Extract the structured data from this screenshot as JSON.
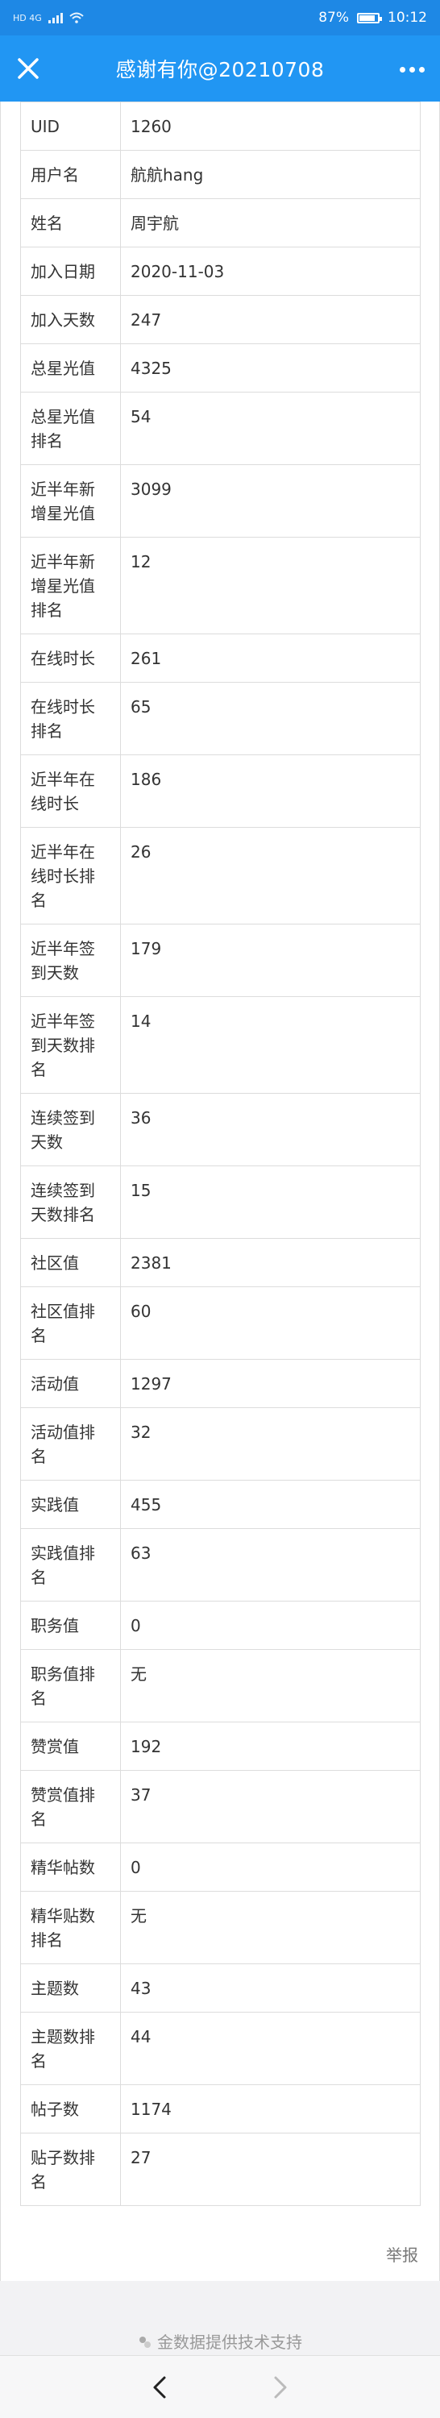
{
  "status_bar": {
    "carrier_text": "HD 4G",
    "battery": "87%",
    "time": "10:12"
  },
  "header": {
    "title": "感谢有你@20210708",
    "close_icon": "close-icon",
    "more_icon": "more-icon"
  },
  "table": {
    "rows": [
      {
        "k": "UID",
        "v": "1260",
        "lines": 1
      },
      {
        "k": "用户名",
        "v": "航航hang",
        "lines": 1
      },
      {
        "k": "姓名",
        "v": "周宇航",
        "lines": 1
      },
      {
        "k": "加入日期",
        "v": "2020-11-03",
        "lines": 1
      },
      {
        "k": "加入天数",
        "v": "247",
        "lines": 1
      },
      {
        "k": "总星光值",
        "v": "4325",
        "lines": 1
      },
      {
        "k": "总星光值排名",
        "v": "54",
        "lines": 2
      },
      {
        "k": "近半年新增星光值",
        "v": "3099",
        "lines": 2
      },
      {
        "k": "近半年新增星光值排名",
        "v": "12",
        "lines": 3
      },
      {
        "k": "在线时长",
        "v": "261",
        "lines": 1
      },
      {
        "k": "在线时长排名",
        "v": "65",
        "lines": 2
      },
      {
        "k": "近半年在线时长",
        "v": "186",
        "lines": 2
      },
      {
        "k": "近半年在线时长排名",
        "v": "26",
        "lines": 3
      },
      {
        "k": "近半年签到天数",
        "v": "179",
        "lines": 2
      },
      {
        "k": "近半年签到天数排名",
        "v": "14",
        "lines": 3
      },
      {
        "k": "连续签到天数",
        "v": "36",
        "lines": 2
      },
      {
        "k": "连续签到天数排名",
        "v": "15",
        "lines": 2
      },
      {
        "k": "社区值",
        "v": "2381",
        "lines": 1
      },
      {
        "k": "社区值排名",
        "v": "60",
        "lines": 2
      },
      {
        "k": "活动值",
        "v": "1297",
        "lines": 1
      },
      {
        "k": "活动值排名",
        "v": "32",
        "lines": 2
      },
      {
        "k": "实践值",
        "v": "455",
        "lines": 1
      },
      {
        "k": "实践值排名",
        "v": "63",
        "lines": 2
      },
      {
        "k": "职务值",
        "v": "0",
        "lines": 1
      },
      {
        "k": "职务值排名",
        "v": "无",
        "lines": 2
      },
      {
        "k": "赞赏值",
        "v": "192",
        "lines": 1
      },
      {
        "k": "赞赏值排名",
        "v": "37",
        "lines": 2
      },
      {
        "k": "精华帖数",
        "v": "0",
        "lines": 1
      },
      {
        "k": "精华贴数排名",
        "v": "无",
        "lines": 2
      },
      {
        "k": "主题数",
        "v": "43",
        "lines": 1
      },
      {
        "k": "主题数排名",
        "v": "44",
        "lines": 2
      },
      {
        "k": "帖子数",
        "v": "1174",
        "lines": 1
      },
      {
        "k": "贴子数排名",
        "v": "27",
        "lines": 2
      }
    ]
  },
  "report_label": "举报",
  "powered_by": "金数据提供技术支持",
  "nav": {
    "back_icon": "chevron-left-icon",
    "forward_icon": "chevron-right-icon"
  },
  "colors": {
    "header": "#2196f3",
    "status_bar": "#1e88e5"
  }
}
